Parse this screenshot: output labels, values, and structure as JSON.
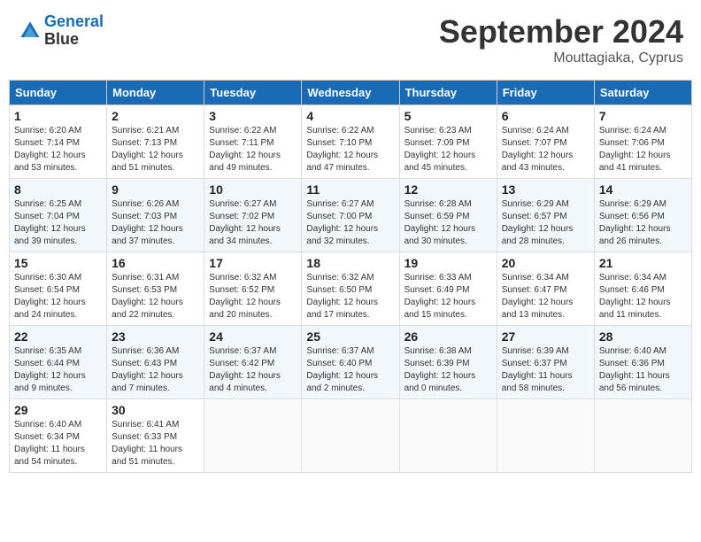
{
  "header": {
    "logo_line1": "General",
    "logo_line2": "Blue",
    "month_title": "September 2024",
    "location": "Mouttagiaka, Cyprus"
  },
  "weekdays": [
    "Sunday",
    "Monday",
    "Tuesday",
    "Wednesday",
    "Thursday",
    "Friday",
    "Saturday"
  ],
  "weeks": [
    [
      {
        "day": "1",
        "sunrise": "6:20 AM",
        "sunset": "7:14 PM",
        "daylight": "12 hours and 53 minutes."
      },
      {
        "day": "2",
        "sunrise": "6:21 AM",
        "sunset": "7:13 PM",
        "daylight": "12 hours and 51 minutes."
      },
      {
        "day": "3",
        "sunrise": "6:22 AM",
        "sunset": "7:11 PM",
        "daylight": "12 hours and 49 minutes."
      },
      {
        "day": "4",
        "sunrise": "6:22 AM",
        "sunset": "7:10 PM",
        "daylight": "12 hours and 47 minutes."
      },
      {
        "day": "5",
        "sunrise": "6:23 AM",
        "sunset": "7:09 PM",
        "daylight": "12 hours and 45 minutes."
      },
      {
        "day": "6",
        "sunrise": "6:24 AM",
        "sunset": "7:07 PM",
        "daylight": "12 hours and 43 minutes."
      },
      {
        "day": "7",
        "sunrise": "6:24 AM",
        "sunset": "7:06 PM",
        "daylight": "12 hours and 41 minutes."
      }
    ],
    [
      {
        "day": "8",
        "sunrise": "6:25 AM",
        "sunset": "7:04 PM",
        "daylight": "12 hours and 39 minutes."
      },
      {
        "day": "9",
        "sunrise": "6:26 AM",
        "sunset": "7:03 PM",
        "daylight": "12 hours and 37 minutes."
      },
      {
        "day": "10",
        "sunrise": "6:27 AM",
        "sunset": "7:02 PM",
        "daylight": "12 hours and 34 minutes."
      },
      {
        "day": "11",
        "sunrise": "6:27 AM",
        "sunset": "7:00 PM",
        "daylight": "12 hours and 32 minutes."
      },
      {
        "day": "12",
        "sunrise": "6:28 AM",
        "sunset": "6:59 PM",
        "daylight": "12 hours and 30 minutes."
      },
      {
        "day": "13",
        "sunrise": "6:29 AM",
        "sunset": "6:57 PM",
        "daylight": "12 hours and 28 minutes."
      },
      {
        "day": "14",
        "sunrise": "6:29 AM",
        "sunset": "6:56 PM",
        "daylight": "12 hours and 26 minutes."
      }
    ],
    [
      {
        "day": "15",
        "sunrise": "6:30 AM",
        "sunset": "6:54 PM",
        "daylight": "12 hours and 24 minutes."
      },
      {
        "day": "16",
        "sunrise": "6:31 AM",
        "sunset": "6:53 PM",
        "daylight": "12 hours and 22 minutes."
      },
      {
        "day": "17",
        "sunrise": "6:32 AM",
        "sunset": "6:52 PM",
        "daylight": "12 hours and 20 minutes."
      },
      {
        "day": "18",
        "sunrise": "6:32 AM",
        "sunset": "6:50 PM",
        "daylight": "12 hours and 17 minutes."
      },
      {
        "day": "19",
        "sunrise": "6:33 AM",
        "sunset": "6:49 PM",
        "daylight": "12 hours and 15 minutes."
      },
      {
        "day": "20",
        "sunrise": "6:34 AM",
        "sunset": "6:47 PM",
        "daylight": "12 hours and 13 minutes."
      },
      {
        "day": "21",
        "sunrise": "6:34 AM",
        "sunset": "6:46 PM",
        "daylight": "12 hours and 11 minutes."
      }
    ],
    [
      {
        "day": "22",
        "sunrise": "6:35 AM",
        "sunset": "6:44 PM",
        "daylight": "12 hours and 9 minutes."
      },
      {
        "day": "23",
        "sunrise": "6:36 AM",
        "sunset": "6:43 PM",
        "daylight": "12 hours and 7 minutes."
      },
      {
        "day": "24",
        "sunrise": "6:37 AM",
        "sunset": "6:42 PM",
        "daylight": "12 hours and 4 minutes."
      },
      {
        "day": "25",
        "sunrise": "6:37 AM",
        "sunset": "6:40 PM",
        "daylight": "12 hours and 2 minutes."
      },
      {
        "day": "26",
        "sunrise": "6:38 AM",
        "sunset": "6:39 PM",
        "daylight": "12 hours and 0 minutes."
      },
      {
        "day": "27",
        "sunrise": "6:39 AM",
        "sunset": "6:37 PM",
        "daylight": "11 hours and 58 minutes."
      },
      {
        "day": "28",
        "sunrise": "6:40 AM",
        "sunset": "6:36 PM",
        "daylight": "11 hours and 56 minutes."
      }
    ],
    [
      {
        "day": "29",
        "sunrise": "6:40 AM",
        "sunset": "6:34 PM",
        "daylight": "11 hours and 54 minutes."
      },
      {
        "day": "30",
        "sunrise": "6:41 AM",
        "sunset": "6:33 PM",
        "daylight": "11 hours and 51 minutes."
      },
      null,
      null,
      null,
      null,
      null
    ]
  ]
}
